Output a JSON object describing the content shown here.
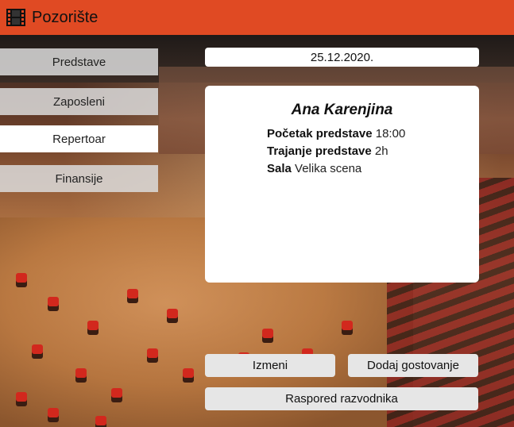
{
  "app": {
    "title": "Pozorište",
    "icon": "film-strip-icon"
  },
  "sidebar": {
    "items": [
      {
        "label": "Predstave",
        "active": false
      },
      {
        "label": "Zaposleni",
        "active": false
      },
      {
        "label": "Repertoar",
        "active": true
      },
      {
        "label": "Finansije",
        "active": false
      }
    ]
  },
  "date": "25.12.2020.",
  "show": {
    "title": "Ana Karenjina",
    "start_label": "Početak predstave",
    "start_value": "18:00",
    "duration_label": "Trajanje predstave",
    "duration_value": "2h",
    "hall_label": "Sala",
    "hall_value": "Velika scena"
  },
  "actions": {
    "edit_label": "Izmeni",
    "add_guest_label": "Dodaj gostovanje",
    "usher_schedule_label": "Raspored razvodnika"
  },
  "colors": {
    "header": "#e04a23",
    "button": "#e6e6e6",
    "card": "#ffffff"
  }
}
